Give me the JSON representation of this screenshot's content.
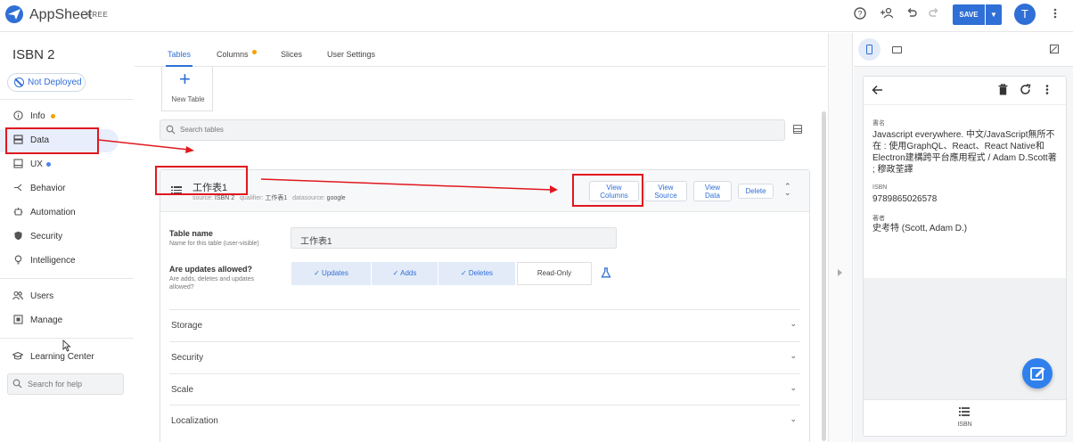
{
  "header": {
    "brand": "AppSheet",
    "plan_badge": "FREE",
    "save_label": "SAVE",
    "avatar_letter": "T"
  },
  "sidebar": {
    "app_name": "ISBN 2",
    "deploy_status": "Not Deployed",
    "items": [
      {
        "label": "Info",
        "icon": "info-icon"
      },
      {
        "label": "Data",
        "icon": "data-icon"
      },
      {
        "label": "UX",
        "icon": "ux-icon"
      },
      {
        "label": "Behavior",
        "icon": "behavior-icon"
      },
      {
        "label": "Automation",
        "icon": "automation-icon"
      },
      {
        "label": "Security",
        "icon": "shield-icon"
      },
      {
        "label": "Intelligence",
        "icon": "bulb-icon"
      },
      {
        "label": "Users",
        "icon": "users-icon"
      },
      {
        "label": "Manage",
        "icon": "manage-icon"
      },
      {
        "label": "Learning Center",
        "icon": "graduation-cap-icon"
      }
    ],
    "search_placeholder": "Search for help"
  },
  "main": {
    "tabs": [
      {
        "label": "Tables"
      },
      {
        "label": "Columns"
      },
      {
        "label": "Slices"
      },
      {
        "label": "User Settings"
      }
    ],
    "new_table_label": "New Table",
    "search_placeholder": "Search tables",
    "table": {
      "name": "工作表1",
      "source_label": "source:",
      "source_value": "ISBN 2",
      "qualifier_label": "qualifier:",
      "qualifier_value": "工作表1",
      "datasource_label": "datasource:",
      "datasource_value": "google",
      "buttons": {
        "view_columns": [
          "View",
          "Columns"
        ],
        "view_source": [
          "View",
          "Source"
        ],
        "view_data": [
          "View",
          "Data"
        ],
        "delete": "Delete"
      },
      "table_name_label": "Table name",
      "table_name_hint": "Name for this table (user-visible)",
      "table_name_value": "工作表1",
      "updates_label": "Are updates allowed?",
      "updates_hint": [
        "Are adds, deletes and updates",
        "allowed?"
      ],
      "update_options": [
        "✓ Updates",
        "✓ Adds",
        "✓ Deletes",
        "Read-Only"
      ],
      "sections": [
        "Storage",
        "Security",
        "Scale",
        "Localization"
      ]
    }
  },
  "preview": {
    "record": [
      {
        "label": "書名",
        "value": "Javascript everywhere. 中文/JavaScript無所不在 : 使用GraphQL、React、React Native和Electron建構跨平台應用程式 / Adam D.Scott著 ; 穆政荃譯"
      },
      {
        "label": "ISBN",
        "value": "9789865026578"
      },
      {
        "label": "著者",
        "value": "史考特 (Scott, Adam D.)"
      }
    ],
    "nav_label": "ISBN"
  },
  "colors": {
    "accent": "#2f6fd6",
    "annotation_red": "#e0181e",
    "status_dot_orange": "#f4a100",
    "status_dot_blue": "#4a86e8"
  }
}
